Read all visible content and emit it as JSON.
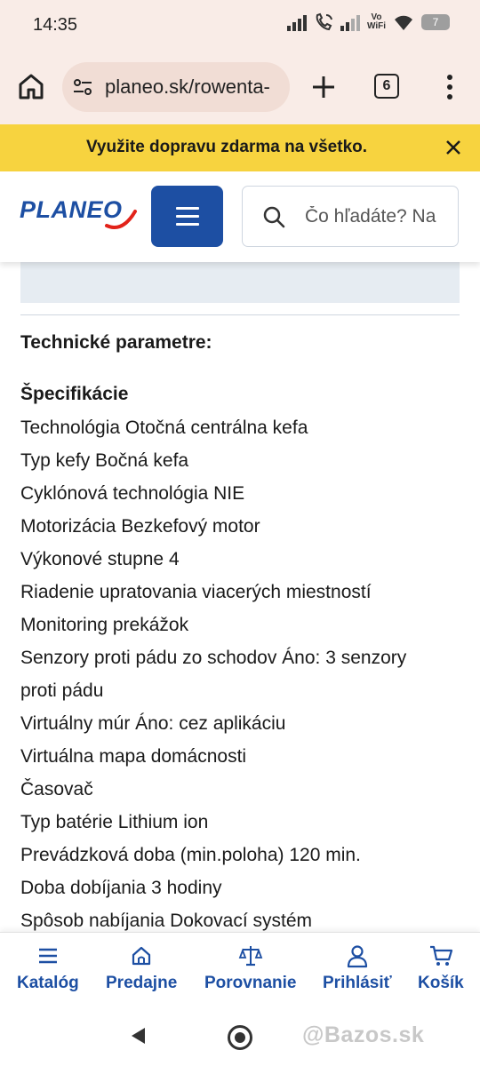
{
  "status_bar": {
    "time": "14:35",
    "vowifi_top": "Vo",
    "vowifi_bottom": "WiFi",
    "battery": "7"
  },
  "browser": {
    "url": "planeo.sk/rowenta-",
    "tab_count": "6"
  },
  "promo": {
    "text": "Využite dopravu zdarma na všetko."
  },
  "header": {
    "logo": "PLANEO",
    "search_placeholder": "Čo hľadáte? Na"
  },
  "content": {
    "tech_title": "Technické parametre:",
    "spec_title": "Špecifikácie",
    "specs": [
      "Technológia Otočná centrálna kefa",
      "Typ kefy Bočná kefa",
      "Cyklónová technológia NIE",
      "Motorizácia Bezkefový motor",
      "Výkonové stupne 4",
      "Riadenie upratovania viacerých miestností",
      "Monitoring prekážok",
      "Senzory proti pádu zo schodov Áno: 3 senzory",
      "proti pádu",
      "Virtuálny múr Áno: cez aplikáciu",
      "Virtuálna mapa domácnosti",
      "Časovač",
      "Typ batérie Lithium ion",
      "Prevádzková doba (min.poloha) 120 min.",
      "Doba dobíjania 3 hodiny",
      "Spôsob nabíjania Dokovací systém"
    ]
  },
  "bottom_nav": {
    "items": [
      {
        "label": "Katalóg",
        "icon": "menu-icon"
      },
      {
        "label": "Predajne",
        "icon": "store-icon"
      },
      {
        "label": "Porovnanie",
        "icon": "scale-icon"
      },
      {
        "label": "Prihlásiť",
        "icon": "user-icon"
      },
      {
        "label": "Košík",
        "icon": "cart-icon"
      }
    ]
  },
  "watermark": "@Bazos.sk",
  "colors": {
    "brand_blue": "#1d4fa3",
    "promo_yellow": "#f7d33f",
    "chrome_bg": "#f9ece7",
    "logo_red": "#e2231a"
  }
}
